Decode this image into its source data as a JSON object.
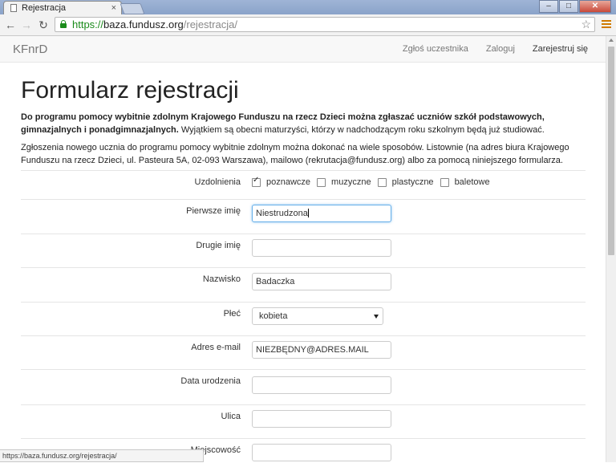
{
  "browser": {
    "tab_title": "Rejestracja",
    "tab_close": "×",
    "url_scheme": "https://",
    "url_host": "baza.fundusz.org",
    "url_path": "/rejestracja/",
    "status_url": "https://baza.fundusz.org/rejestracja/",
    "window_buttons": {
      "minimize": "–",
      "maximize": "□",
      "close": "✕"
    }
  },
  "navbar": {
    "brand": "KFnrD",
    "links": [
      "Zgłoś uczestnika",
      "Zaloguj",
      "Zarejestruj się"
    ]
  },
  "page": {
    "title": "Formularz rejestracji",
    "lead_bold": "Do programu pomocy wybitnie zdolnym Krajowego Funduszu na rzecz Dzieci można zgłaszać uczniów szkół podstawowych, gimnazjalnych i ponadgimnazjalnych.",
    "lead_rest": " Wyjątkiem są obecni maturzyści, którzy w nadchodzącym roku szkolnym będą już studiować.",
    "paragraph": "Zgłoszenia nowego ucznia do programu pomocy wybitnie zdolnym można dokonać na wiele sposobów. Listownie (na adres biura Krajowego Funduszu na rzecz Dzieci, ul. Pasteura 5A, 02-093 Warszawa), mailowo (rekrutacja@fundusz.org) albo za pomocą niniejszego formularza."
  },
  "form": {
    "talents_label": "Uzdolnienia",
    "talents": [
      {
        "label": "poznawcze",
        "checked": true
      },
      {
        "label": "muzyczne",
        "checked": false
      },
      {
        "label": "plastyczne",
        "checked": false
      },
      {
        "label": "baletowe",
        "checked": false
      }
    ],
    "first_name_label": "Pierwsze imię",
    "first_name_value": "Niestrudzona",
    "second_name_label": "Drugie imię",
    "second_name_value": "",
    "surname_label": "Nazwisko",
    "surname_value": "Badaczka",
    "gender_label": "Płeć",
    "gender_value": "kobieta",
    "email_label": "Adres e-mail",
    "email_value": "NIEZBĘDNY@ADRES.MAIL",
    "birthdate_label": "Data urodzenia",
    "birthdate_value": "",
    "street_label": "Ulica",
    "street_value": "",
    "city_label": "Miejscowość"
  }
}
